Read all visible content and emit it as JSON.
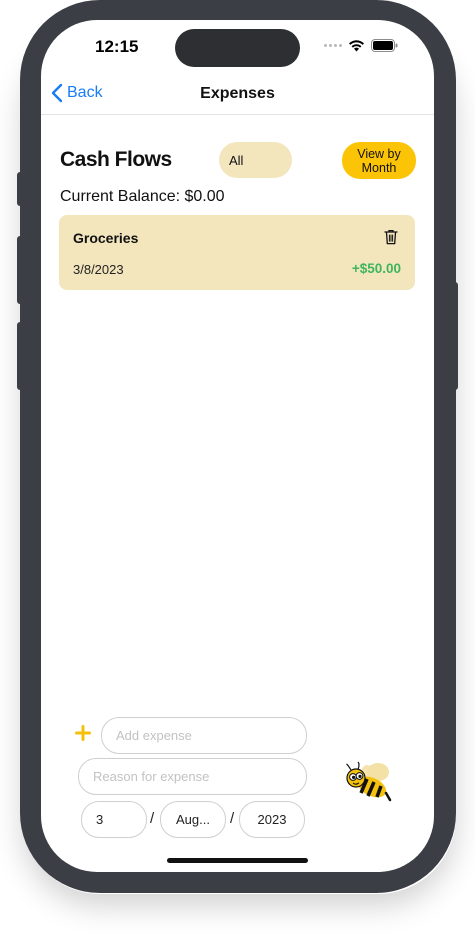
{
  "status_bar": {
    "time": "12:15"
  },
  "navbar": {
    "back_label": "Back",
    "title": "Expenses"
  },
  "header": {
    "title": "Cash Flows",
    "filter_value": "All",
    "view_button_label": "View by Month"
  },
  "balance": {
    "label": "Current Balance: $0.00"
  },
  "transactions": [
    {
      "name": "Groceries",
      "date": "3/8/2023",
      "amount": "+$50.00"
    }
  ],
  "form": {
    "expense_placeholder": "Add expense",
    "reason_placeholder": "Reason for expense",
    "day_value": "3",
    "month_value": "Aug...",
    "year_value": "2023",
    "separator": "/"
  },
  "colors": {
    "accent_yellow": "#fcc406",
    "card_background": "#f3e6bd",
    "positive_amount": "#3fb55d",
    "link_blue": "#1a7cf5"
  },
  "icons": [
    "back-chevron-icon",
    "wifi-icon",
    "battery-icon",
    "trash-icon",
    "plus-icon",
    "bee-logo"
  ]
}
